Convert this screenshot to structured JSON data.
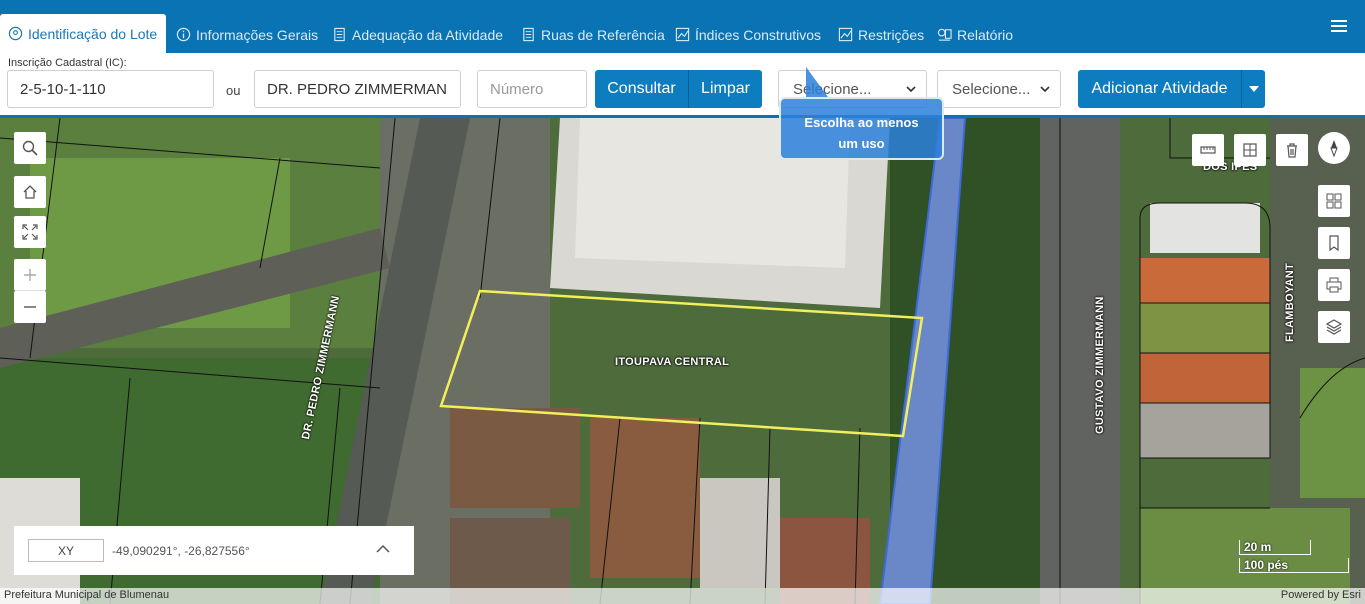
{
  "tabs": [
    {
      "label": "Identificação do Lote",
      "icon": "map-pin-icon"
    },
    {
      "label": "Informações Gerais",
      "icon": "info-icon"
    },
    {
      "label": "Adequação da Atividade",
      "icon": "document-icon"
    },
    {
      "label": "Ruas de Referência",
      "icon": "document-icon"
    },
    {
      "label": "Índices Construtivos",
      "icon": "chart-icon"
    },
    {
      "label": "Restrições",
      "icon": "restriction-icon"
    },
    {
      "label": "Relatório",
      "icon": "report-icon"
    }
  ],
  "form": {
    "ic_label": "Inscrição Cadastral (IC):",
    "ic_value": "2-5-10-1-110",
    "ou": "ou",
    "street_value": "DR. PEDRO ZIMMERMANN",
    "number_placeholder": "Número",
    "consultar": "Consultar",
    "limpar": "Limpar",
    "select1": "Selecione...",
    "select2": "Selecione...",
    "adicionar": "Adicionar Atividade"
  },
  "tooltip": {
    "line1": "Escolha ao menos",
    "line2": "um uso"
  },
  "map": {
    "labels": {
      "bairro": "ITOUPAVA CENTRAL",
      "rua1": "DR. PEDRO ZIMMERMANN",
      "rua2": "GUSTAVO ZIMMERMANN",
      "rua3": "FLAMBOYANT",
      "rua4": "DOS IPÊS"
    },
    "coord_mode": "XY",
    "coord_value": "-49,090291°, -26,827556°",
    "scale_m": "20 m",
    "scale_ft": "100 pés",
    "attribution_left": "Prefeitura Municipal de Blumenau",
    "attribution_right": "Powered by Esri"
  },
  "colors": {
    "primary": "#0a73b3",
    "button": "#0d7dbf",
    "parcel": "#f2ef5c"
  }
}
